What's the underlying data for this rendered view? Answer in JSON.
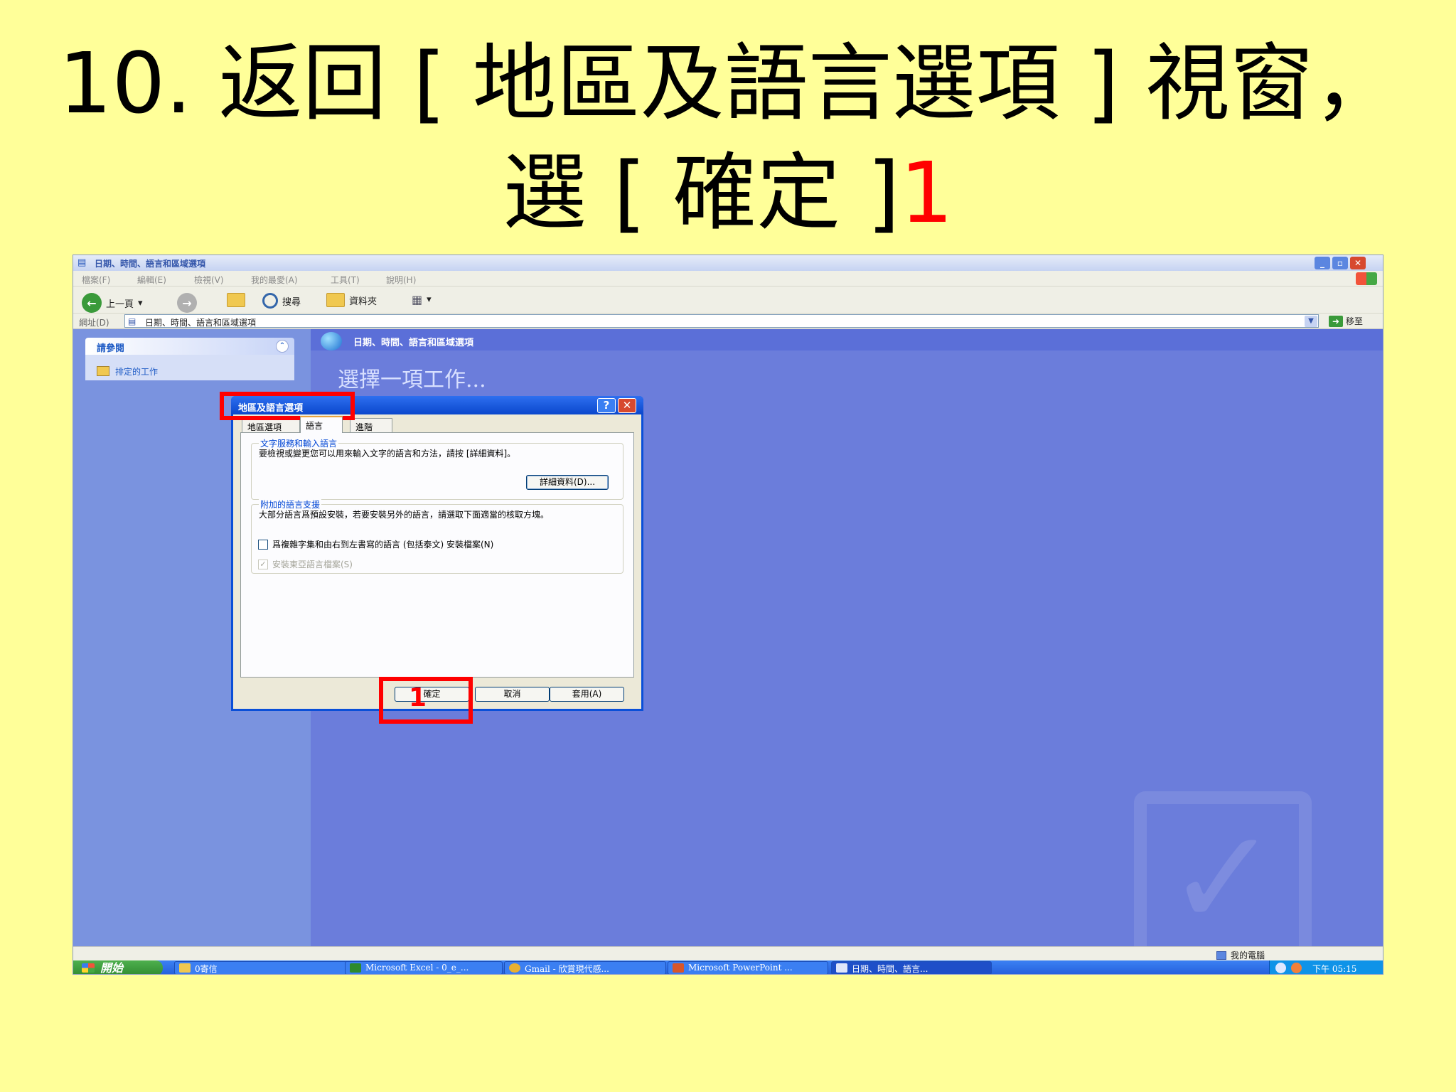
{
  "slide": {
    "title_line1": "10. 返回 [ 地區及語言選項 ] 視窗，",
    "title_line2_text": "選 [ 確定 ]",
    "title_line2_num": "1",
    "accent_color": "#ff0000",
    "background_color": "#ffff99"
  },
  "explorer": {
    "title": "日期、時間、語言和區域選項",
    "menu": [
      "檔案(F)",
      "編輯(E)",
      "檢視(V)",
      "我的最愛(A)",
      "工具(T)",
      "說明(H)"
    ],
    "toolbar": {
      "back_label": "上一頁",
      "search_label": "搜尋",
      "folders_label": "資料夾"
    },
    "address": {
      "label": "網址(D)",
      "value": "日期、時間、語言和區域選項",
      "go_label": "移至"
    },
    "see_also": {
      "header": "請參閱",
      "items": [
        "排定的工作"
      ]
    },
    "main": {
      "header": "日期、時間、語言和區域選項",
      "pick_task": "選擇一項工作..."
    },
    "status": {
      "computer": "我的電腦"
    }
  },
  "dialog": {
    "title": "地區及語言選項",
    "tabs": [
      "地區選項",
      "語言",
      "進階"
    ],
    "active_tab": "語言",
    "text_services": {
      "legend": "文字服務和輸入語言",
      "description": "要檢視或變更您可以用來輸入文字的語言和方法，請按 [詳細資料]。",
      "details_button": "詳細資料(D)..."
    },
    "supplemental": {
      "legend": "附加的語言支援",
      "description": "大部分語言爲預設安裝，若要安裝另外的語言，請選取下面適當的核取方塊。",
      "complex_script_label": "爲複雜字集和由右到左書寫的語言 (包括泰文) 安裝檔案(N)",
      "complex_script_checked": false,
      "east_asian_label": "安裝東亞語言檔案(S)",
      "east_asian_checked": true,
      "east_asian_enabled": false
    },
    "buttons": {
      "ok": "確定",
      "cancel": "取消",
      "apply": "套用(A)"
    }
  },
  "annotation": {
    "ok_marker": "1"
  },
  "taskbar": {
    "start_label": "開始",
    "items": [
      "0寄信",
      "Microsoft Excel - 0_e_...",
      "Gmail - 欣賞現代感...",
      "Microsoft PowerPoint ...",
      "日期、時間、語言..."
    ],
    "active_item": "日期、時間、語言...",
    "clock": "下午 05:15"
  }
}
